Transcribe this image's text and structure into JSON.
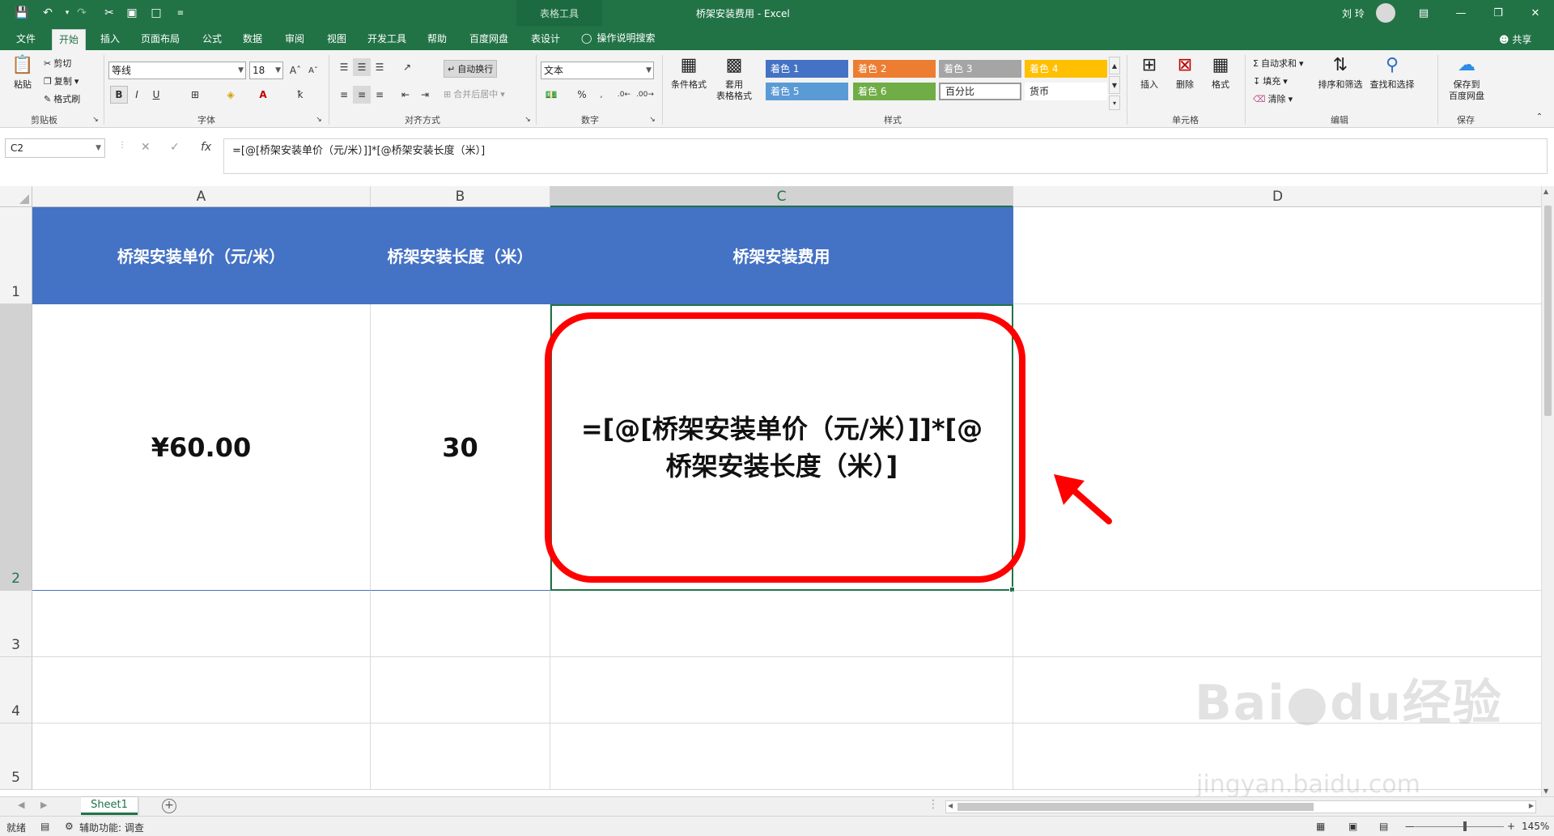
{
  "titlebar": {
    "context_tab": "表格工具",
    "window_title": "桥架安装费用  -  Excel",
    "user": "刘 玲"
  },
  "tabs": {
    "items": [
      "文件",
      "开始",
      "插入",
      "页面布局",
      "公式",
      "数据",
      "审阅",
      "视图",
      "开发工具",
      "帮助",
      "百度网盘",
      "表设计"
    ],
    "active": "开始",
    "tell_me": "操作说明搜索",
    "share": "共享"
  },
  "ribbon": {
    "clipboard": {
      "paste": "粘贴",
      "cut": "剪切",
      "copy": "复制",
      "format_painter": "格式刷",
      "label": "剪贴板"
    },
    "font": {
      "name": "等线",
      "size": "18",
      "label": "字体",
      "bold": "B",
      "italic": "I",
      "underline": "U"
    },
    "alignment": {
      "wrap": "自动换行",
      "merge": "合并后居中",
      "label": "对齐方式"
    },
    "number": {
      "format": "文本",
      "label": "数字"
    },
    "styles": {
      "conditional": "条件格式",
      "table_format_line1": "套用",
      "table_format_line2": "表格格式",
      "cells": [
        {
          "text": "着色 1",
          "color": "#4472c4"
        },
        {
          "text": "着色 2",
          "color": "#ed7d31"
        },
        {
          "text": "着色 3",
          "color": "#a5a5a5"
        },
        {
          "text": "着色 4",
          "color": "#ffc000"
        },
        {
          "text": "着色 5",
          "color": "#5b9bd5"
        },
        {
          "text": "着色 6",
          "color": "#70ad47"
        },
        {
          "text": "百分比",
          "color": "#ffffff"
        },
        {
          "text": "货币",
          "color": "#ffffff"
        }
      ],
      "label": "样式"
    },
    "cells": {
      "insert": "插入",
      "delete": "删除",
      "format": "格式",
      "label": "单元格"
    },
    "editing": {
      "autosum": "自动求和",
      "fill": "填充",
      "clear": "清除",
      "sort": "排序和筛选",
      "find": "查找和选择",
      "label": "编辑"
    },
    "save": {
      "line1": "保存到",
      "line2": "百度网盘",
      "label": "保存"
    }
  },
  "formula_bar": {
    "name_box": "C2",
    "fx": "fx",
    "formula": "=[@[桥架安装单价（元/米）]]*[@桥架安装长度（米）]"
  },
  "grid": {
    "columns": [
      "A",
      "B",
      "C",
      "D"
    ],
    "selected_column": "C",
    "rows": [
      "1",
      "2",
      "3",
      "4",
      "5"
    ],
    "selected_row": "2",
    "header_fill": "#4472c4",
    "header_row": [
      "桥架安装单价（元/米）",
      "桥架安装长度（米）",
      "桥架安装费用"
    ],
    "data_row": [
      "¥60.00",
      "30",
      "=[@[桥架安装单价（元/米）]]*[@桥架安装长度（米）]"
    ]
  },
  "sheets": {
    "active": "Sheet1"
  },
  "statusbar": {
    "ready": "就绪",
    "accessibility": "辅助功能: 调查",
    "zoom": "145%"
  },
  "watermark": {
    "line1": "Baidu经验",
    "line2": "jingyan.baidu.com"
  },
  "annotation_color": "#ff0000"
}
